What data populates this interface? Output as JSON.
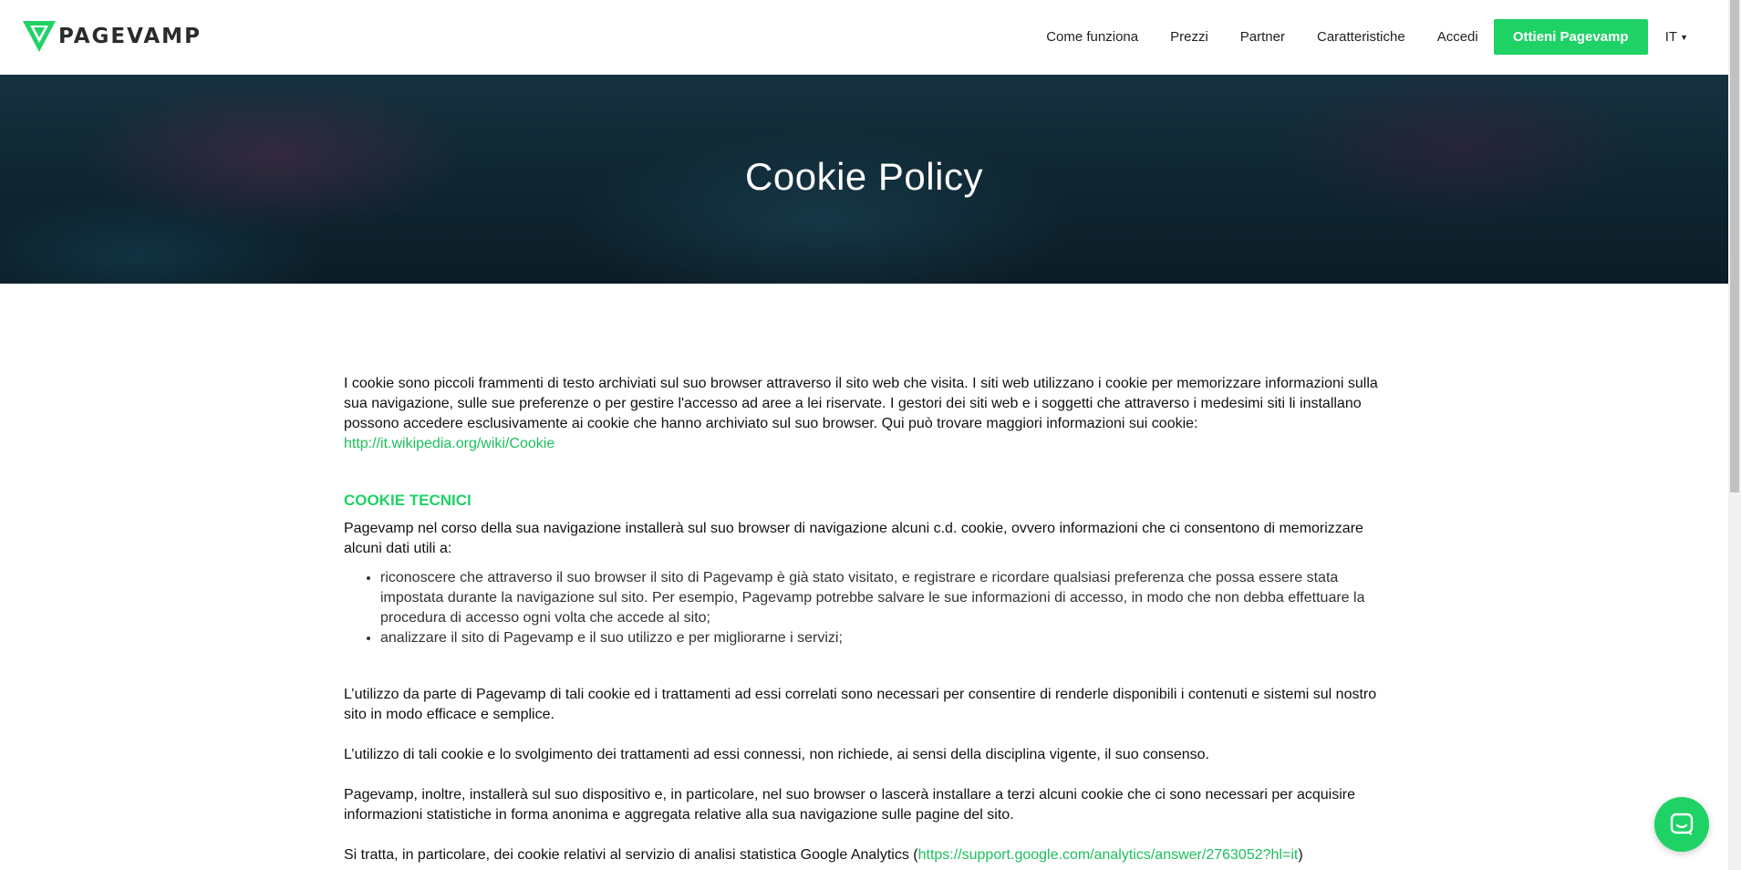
{
  "header": {
    "logo_text": "PAGEVAMP",
    "nav": [
      {
        "label": "Come funziona"
      },
      {
        "label": "Prezzi"
      },
      {
        "label": "Partner"
      },
      {
        "label": "Caratteristiche"
      },
      {
        "label": "Accedi"
      }
    ],
    "cta_label": "Ottieni Pagevamp",
    "language": "IT"
  },
  "hero": {
    "title": "Cookie Policy"
  },
  "content": {
    "intro_text": "I cookie sono piccoli frammenti di testo archiviati sul suo browser attraverso il sito web che visita. I siti web utilizzano i cookie per memorizzare informazioni sulla sua navigazione, sulle sue preferenze o per gestire l'accesso ad aree a lei riservate. I gestori dei siti web e i soggetti che attraverso i medesimi siti li installano possono accedere esclusivamente ai cookie che hanno archiviato sul suo browser. Qui può trovare maggiori informazioni sui cookie: ",
    "intro_link": "http://it.wikipedia.org/wiki/Cookie",
    "section_title": "COOKIE TECNICI",
    "section_intro": "Pagevamp nel corso della sua navigazione installerà sul suo browser di navigazione alcuni c.d. cookie, ovvero informazioni che ci consentono di memorizzare alcuni dati utili a:",
    "bullets": [
      "riconoscere che attraverso il suo browser il sito di Pagevamp è già stato visitato, e registrare e ricordare qualsiasi preferenza che possa essere stata impostata durante la navigazione sul sito. Per esempio, Pagevamp potrebbe salvare le sue informazioni di accesso, in modo che non debba effettuare la procedura di accesso ogni volta che accede al sito;",
      "analizzare il sito di Pagevamp e il suo utilizzo e per migliorarne i servizi;"
    ],
    "para1": "L’utilizzo da parte di Pagevamp di tali cookie ed i trattamenti ad essi correlati sono necessari per consentire di renderle disponibili i contenuti e sistemi sul nostro sito in modo efficace e semplice.",
    "para2": "L’utilizzo di tali cookie e lo svolgimento dei trattamenti ad essi connessi, non richiede, ai sensi della disciplina vigente, il suo consenso.",
    "para3": "Pagevamp, inoltre, installerà sul suo dispositivo e, in particolare, nel suo browser o lascerà installare a terzi alcuni cookie che ci sono necessari per acquisire informazioni statistiche in forma anonima e aggregata relative alla sua navigazione sulle pagine del sito.",
    "para4_text": "Si tratta, in particolare, dei cookie relativi al servizio di analisi statistica Google Analytics (",
    "para4_link": "https://support.google.com/analytics/answer/2763052?hl=it",
    "para4_end": ")"
  },
  "colors": {
    "brand_green": "#1fd266"
  },
  "icons": {
    "logo": "pagevamp-v-logo-icon",
    "chat": "chat-bubble-icon",
    "caret": "caret-down-icon"
  }
}
